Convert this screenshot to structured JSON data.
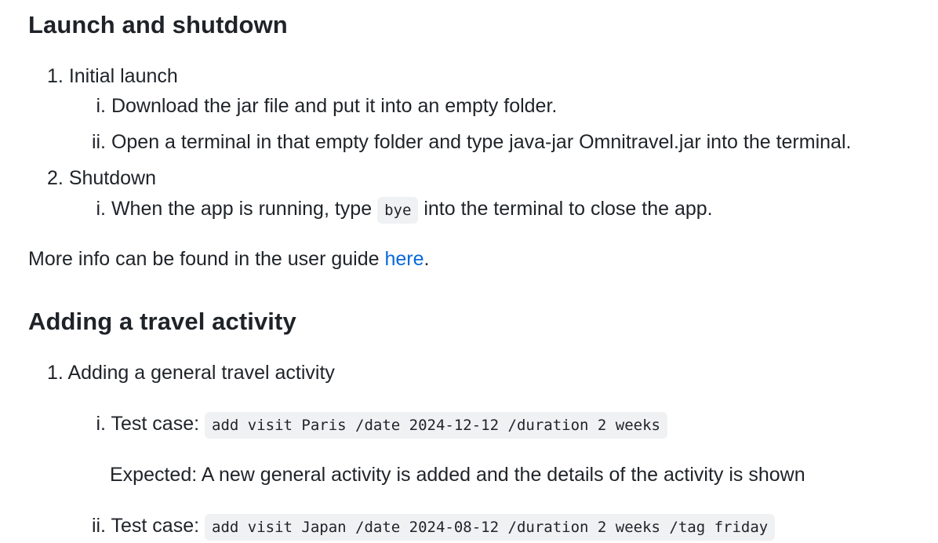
{
  "section1": {
    "heading": "Launch and shutdown",
    "items": [
      {
        "num": "1.",
        "label": "Initial launch",
        "sub": [
          {
            "num": "i.",
            "text": "Download the jar file and put it into an empty folder."
          },
          {
            "num": "ii.",
            "text": "Open a terminal in that empty folder and type java-jar Omnitravel.jar into the terminal."
          }
        ]
      },
      {
        "num": "2.",
        "label": "Shutdown",
        "sub": [
          {
            "num": "i.",
            "before": "When the app is running, type",
            "code": "bye",
            "after": "into the terminal to close the app."
          }
        ]
      }
    ],
    "info_text": "More info can be found in the user guide",
    "info_link": "here",
    "info_end": "."
  },
  "section2": {
    "heading": "Adding a travel activity",
    "items": [
      {
        "num": "1.",
        "label": "Adding a general travel activity",
        "sub": [
          {
            "num": "i.",
            "prefix": "Test case:",
            "code": "add visit Paris /date 2024-12-12 /duration 2 weeks",
            "expected": "Expected: A new general activity is added and the details of the activity is shown"
          },
          {
            "num": "ii.",
            "prefix": "Test case:",
            "code": "add visit Japan /date 2024-08-12 /duration 2 weeks /tag friday"
          }
        ]
      }
    ]
  }
}
